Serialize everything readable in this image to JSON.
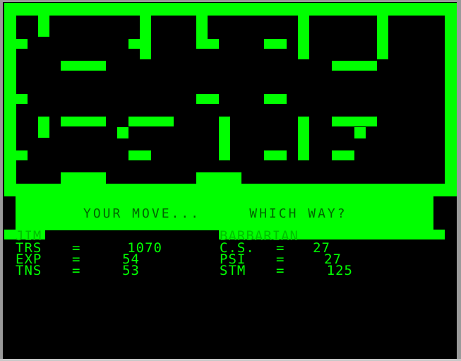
{
  "message": {
    "prompt": "YOUR MOVE...",
    "question": "WHICH WAY?"
  },
  "player": {
    "name": "JIM",
    "class": "BARBARIAN"
  },
  "stats_left": [
    {
      "label": "TRS",
      "value": "1070"
    },
    {
      "label": "EXP",
      "value": "54"
    },
    {
      "label": "TNS",
      "value": "53"
    }
  ],
  "stats_right": [
    {
      "label": "C.S.",
      "value": "27"
    },
    {
      "label": "PSI",
      "value": "27"
    },
    {
      "label": "STM",
      "value": "125"
    }
  ],
  "equals": "=",
  "corner_icon": "close-icon",
  "colors": {
    "phosphor_green": "#00ff00",
    "banner_text": "#006400",
    "background": "#000000"
  }
}
